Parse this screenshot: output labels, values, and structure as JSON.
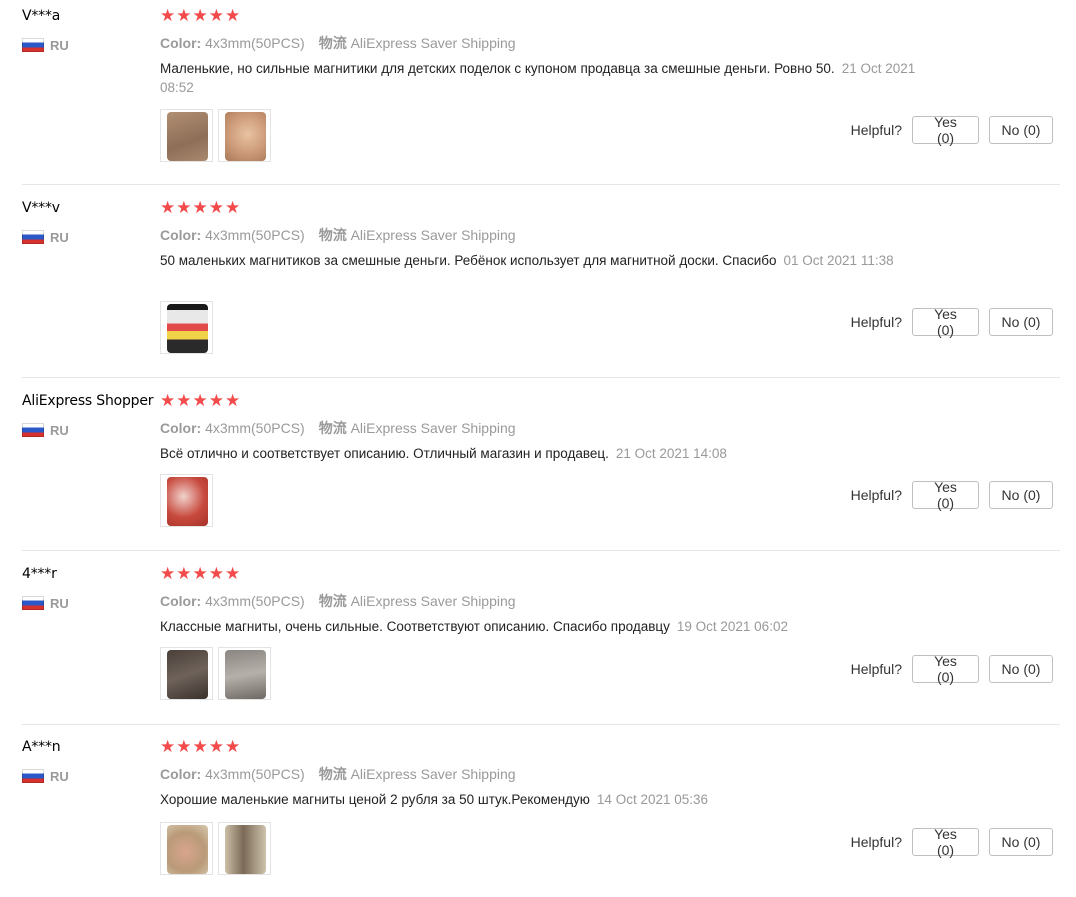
{
  "helpful_label": "Helpful?",
  "colors": {
    "star": "#f34b4b",
    "meta": "#9a9a9a",
    "date": "#999999",
    "divider": "#e6e6e6"
  },
  "reviews": [
    {
      "user": "V***a",
      "country": "RU",
      "stars": 5,
      "color_label": "Color:",
      "color_value": "4x3mm(50PCS)",
      "shipping_label": "物流",
      "shipping_value": "AliExpress Saver Shipping",
      "text": "Маленькие, но сильные магнитики для детских поделок с купоном продавца за смешные деньги. Ровно 50.",
      "date": "21 Oct 2021 08:52",
      "photos": [
        "photo-magnet-on-wood",
        "photo-magnets-in-hand"
      ],
      "yes": "Yes (0)",
      "no": "No (0)"
    },
    {
      "user": "V***v",
      "country": "RU",
      "stars": 5,
      "color_label": "Color:",
      "color_value": "4x3mm(50PCS)",
      "shipping_label": "物流",
      "shipping_value": "AliExpress Saver Shipping",
      "text": "50 маленьких магнитиков за смешные деньги. Ребёнок использует для магнитной доски. Спасибо",
      "date": "01 Oct 2021 11:38",
      "photos": [
        "photo-magnetic-board"
      ],
      "yes": "Yes (0)",
      "no": "No (0)"
    },
    {
      "user": "AliExpress Shopper",
      "country": "RU",
      "stars": 5,
      "color_label": "Color:",
      "color_value": "4x3mm(50PCS)",
      "shipping_label": "物流",
      "shipping_value": "AliExpress Saver Shipping",
      "text": "Всё отлично и соответствует описанию. Отличный магазин и продавец.",
      "date": "21 Oct 2021 14:08",
      "photos": [
        "photo-package"
      ],
      "yes": "Yes (0)",
      "no": "No (0)"
    },
    {
      "user": "4***r",
      "country": "RU",
      "stars": 5,
      "color_label": "Color:",
      "color_value": "4x3mm(50PCS)",
      "shipping_label": "物流",
      "shipping_value": "AliExpress Saver Shipping",
      "text": "Классные магниты, очень сильные. Соответствуют описанию. Спасибо продавцу",
      "date": "19 Oct 2021 06:02",
      "photos": [
        "photo-magnets-dark",
        "photo-magnets-stack"
      ],
      "yes": "Yes (0)",
      "no": "No (0)"
    },
    {
      "user": "A***n",
      "country": "RU",
      "stars": 5,
      "color_label": "Color:",
      "color_value": "4x3mm(50PCS)",
      "shipping_label": "物流",
      "shipping_value": "AliExpress Saver Shipping",
      "text": "Хорошие маленькие магниты ценой 2 рубля за 50 штук.Рекомендую",
      "date": "14 Oct 2021 05:36",
      "photos": [
        "photo-magnets-fingers",
        "photo-magnets-column"
      ],
      "yes": "Yes (0)",
      "no": "No (0)"
    }
  ]
}
